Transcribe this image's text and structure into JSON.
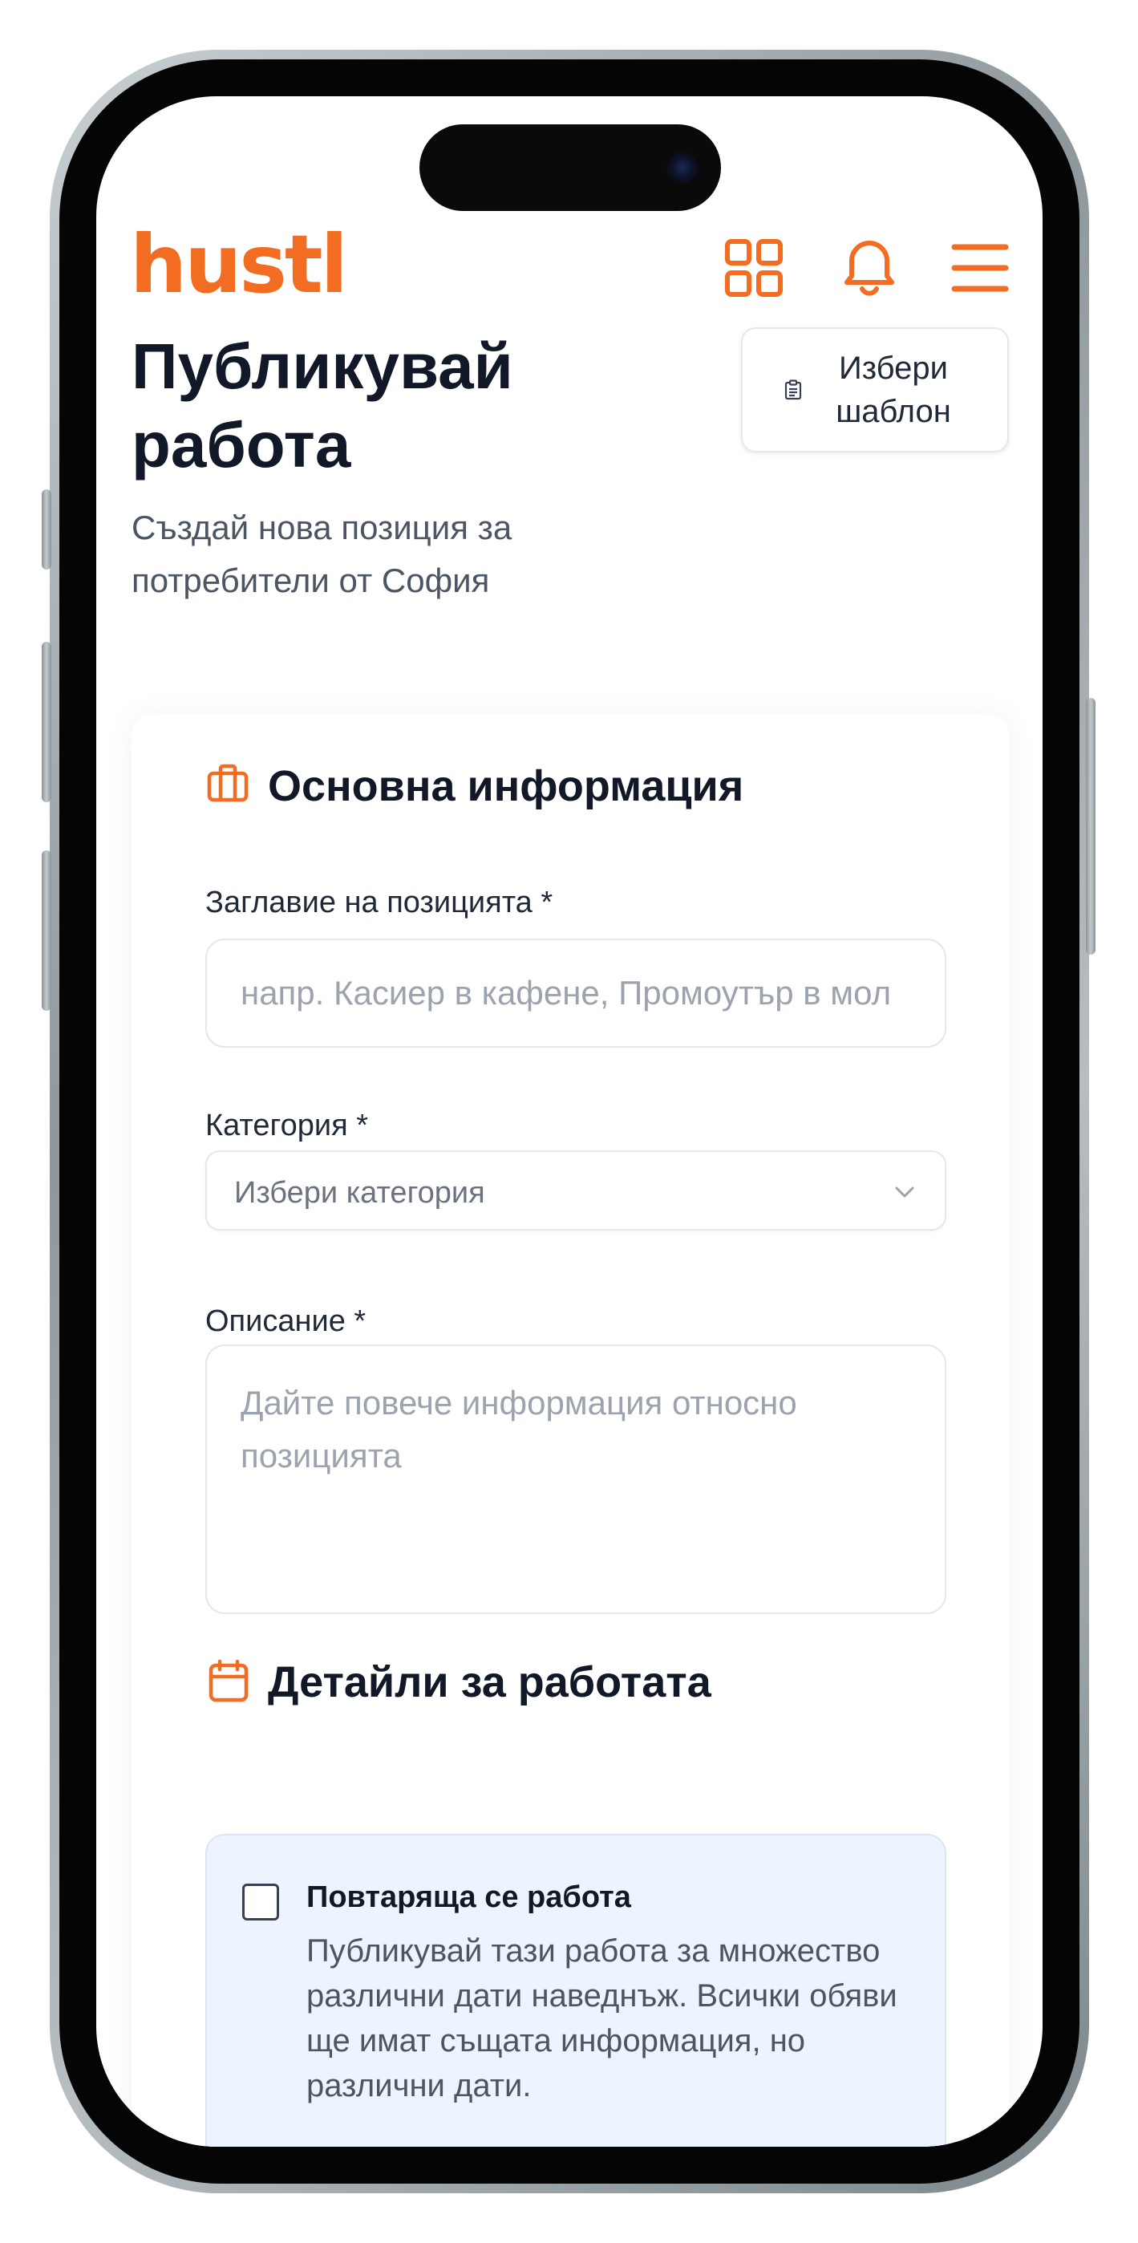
{
  "header": {
    "logo": "hustl",
    "icons": [
      "grid-icon",
      "bell-icon",
      "hamburger-menu-icon"
    ]
  },
  "page": {
    "title": "Публикувай работа",
    "subtitle": "Създай нова позиция за потребители от София",
    "template_button": "Избери шаблон"
  },
  "basic_info": {
    "title": "Основна информация",
    "job_title_label": "Заглавие на позицията *",
    "job_title_placeholder": "напр. Касиер в кафене, Промоутър в мол",
    "job_title_value": "",
    "category_label": "Категория *",
    "category_value": "Избери категория",
    "description_label": "Описание *",
    "description_placeholder": "Дайте повече информация относно позицията",
    "description_value": ""
  },
  "job_details": {
    "title": "Детайли за работата",
    "recurring": {
      "label": "Повтаряща се работа",
      "description": "Публикувай тази работа за множество различни дати наведнъж. Всички обяви ще имат същата информация, но различни дати.",
      "checked": false
    }
  },
  "colors": {
    "accent": "#f26d21",
    "text_primary": "#111827",
    "text_secondary": "#4b5563",
    "info_box_bg": "#eef4fe"
  }
}
